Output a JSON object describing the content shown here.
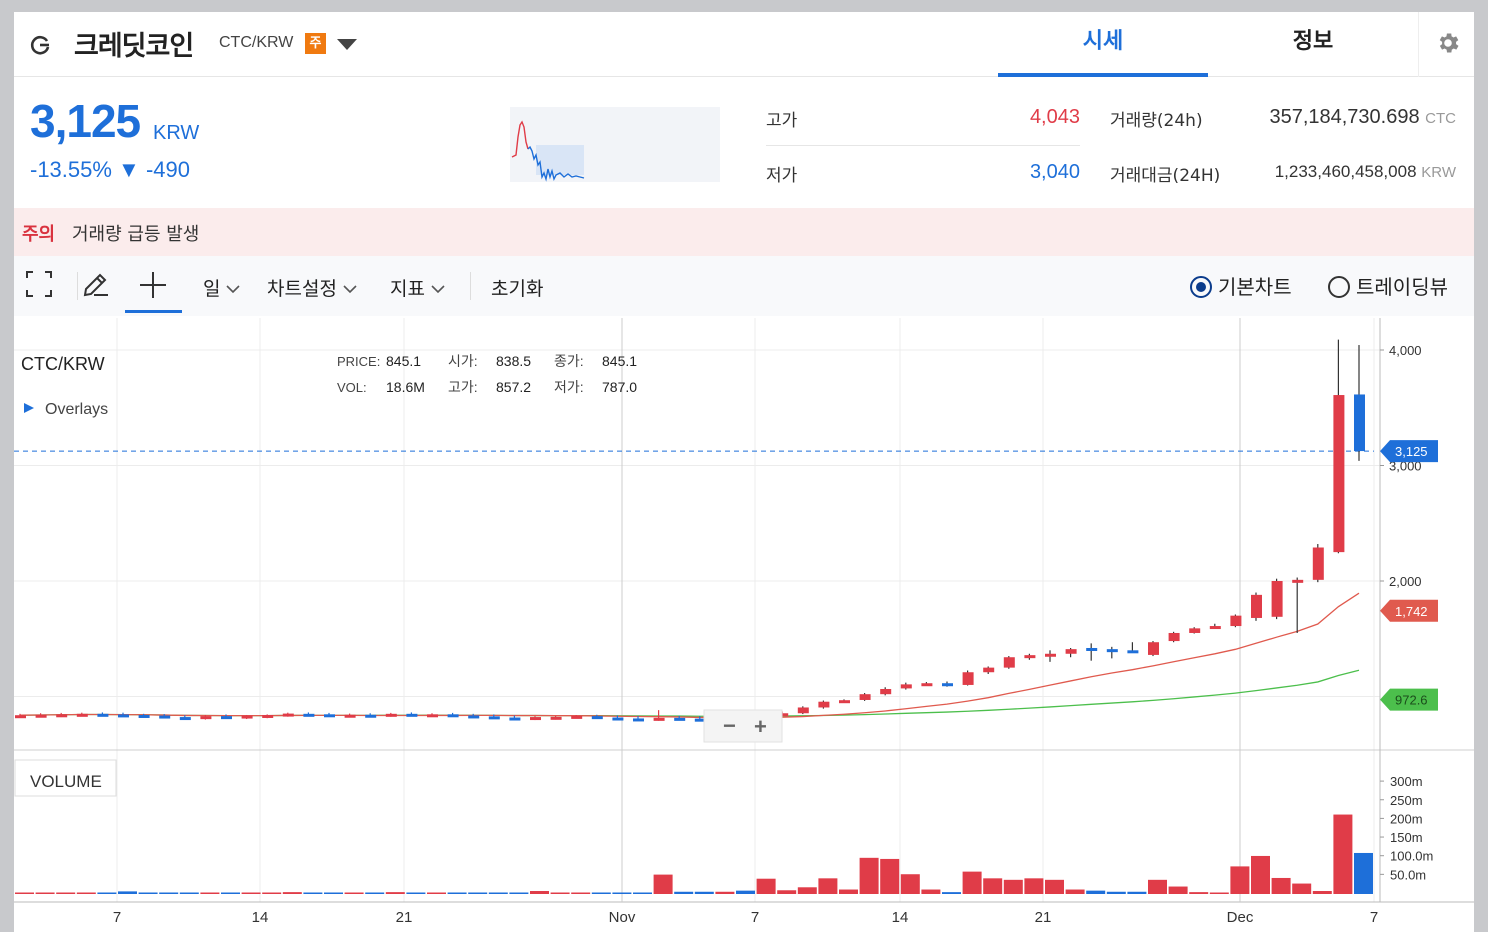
{
  "header": {
    "coin_name": "크레딧코인",
    "pair": "CTC/KRW",
    "warning_badge": "주",
    "tabs": [
      {
        "label": "시세",
        "active": true
      },
      {
        "label": "정보",
        "active": false
      }
    ],
    "icons": {
      "refresh": "refresh-icon",
      "caret": "caret-down-icon",
      "settings": "gear-icon"
    }
  },
  "summary": {
    "price": "3,125",
    "price_unit": "KRW",
    "change": "-13.55% ▼ -490",
    "high_label": "고가",
    "high_value": "4,043",
    "low_label": "저가",
    "low_value": "3,040",
    "volume_label": "거래량(24h)",
    "volume_value": "357,184,730.698",
    "volume_unit": "CTC",
    "amount_label": "거래대금(24H)",
    "amount_value": "1,233,460,458,008",
    "amount_unit": "KRW"
  },
  "notice": {
    "tag": "주의",
    "text": "거래량 급등 발생"
  },
  "toolbar": {
    "interval": "일",
    "chart_settings": "차트설정",
    "indicators": "지표",
    "reset": "초기화",
    "radio_basic": "기본차트",
    "radio_tradingview": "트레이딩뷰",
    "selected": "기본차트"
  },
  "colors": {
    "up": "#e03c48",
    "down": "#1e6fd9",
    "accent": "#1e6fd9",
    "ma_short": "#e05a4e",
    "ma_long": "#4cbf4c"
  },
  "chart_info": {
    "symbol": "CTC/KRW",
    "overlays": "Overlays",
    "price_label": "PRICE:",
    "price": "845.1",
    "open_label": "시가:",
    "open": "838.5",
    "close_label": "종가:",
    "close": "845.1",
    "vol_label": "VOL:",
    "vol": "18.6M",
    "high_label": "고가:",
    "high": "857.2",
    "low_label": "저가:",
    "low": "787.0",
    "volume_title": "VOLUME",
    "zoom_out": "−",
    "zoom_in": "+"
  },
  "chart_data": {
    "type": "candlestick",
    "price_axis": {
      "ticks": [
        "4,000",
        "3,000",
        "2,000"
      ],
      "values": [
        4000,
        3000,
        2000
      ]
    },
    "volume_axis": {
      "ticks": [
        "300m",
        "250m",
        "200m",
        "150m",
        "100.0m",
        "50.0m"
      ],
      "values": [
        300,
        250,
        200,
        150,
        100,
        50
      ]
    },
    "x_labels": [
      "7",
      "14",
      "21",
      "Nov",
      "7",
      "14",
      "21",
      "Dec",
      "7"
    ],
    "price_markers": [
      {
        "label": "3,125",
        "value": 3125,
        "color": "#1e6fd9"
      },
      {
        "label": "1,742",
        "value": 1742,
        "color": "#e05a4e"
      },
      {
        "label": "972.6",
        "value": 972.6,
        "color": "#4cbf4c"
      }
    ],
    "candles": [
      {
        "o": 830,
        "h": 850,
        "l": 815,
        "c": 838,
        "v": 2
      },
      {
        "o": 835,
        "h": 855,
        "l": 820,
        "c": 842,
        "v": 2
      },
      {
        "o": 840,
        "h": 858,
        "l": 822,
        "c": 846,
        "v": 2
      },
      {
        "o": 846,
        "h": 860,
        "l": 830,
        "c": 850,
        "v": 2
      },
      {
        "o": 850,
        "h": 862,
        "l": 835,
        "c": 844,
        "v": 2
      },
      {
        "o": 845,
        "h": 860,
        "l": 830,
        "c": 840,
        "v": 7
      },
      {
        "o": 840,
        "h": 850,
        "l": 825,
        "c": 834,
        "v": 2
      },
      {
        "o": 835,
        "h": 848,
        "l": 818,
        "c": 822,
        "v": 2
      },
      {
        "o": 822,
        "h": 838,
        "l": 805,
        "c": 810,
        "v": 2
      },
      {
        "o": 812,
        "h": 840,
        "l": 800,
        "c": 830,
        "v": 2
      },
      {
        "o": 830,
        "h": 845,
        "l": 815,
        "c": 820,
        "v": 2
      },
      {
        "o": 822,
        "h": 840,
        "l": 805,
        "c": 835,
        "v": 2
      },
      {
        "o": 825,
        "h": 845,
        "l": 812,
        "c": 840,
        "v": 2
      },
      {
        "o": 835,
        "h": 860,
        "l": 825,
        "c": 852,
        "v": 5
      },
      {
        "o": 850,
        "h": 862,
        "l": 832,
        "c": 846,
        "v": 2
      },
      {
        "o": 846,
        "h": 858,
        "l": 828,
        "c": 834,
        "v": 2
      },
      {
        "o": 834,
        "h": 852,
        "l": 820,
        "c": 842,
        "v": 2
      },
      {
        "o": 842,
        "h": 855,
        "l": 826,
        "c": 838,
        "v": 2
      },
      {
        "o": 838,
        "h": 858,
        "l": 825,
        "c": 850,
        "v": 5
      },
      {
        "o": 850,
        "h": 862,
        "l": 832,
        "c": 840,
        "v": 2
      },
      {
        "o": 842,
        "h": 855,
        "l": 828,
        "c": 846,
        "v": 2
      },
      {
        "o": 846,
        "h": 858,
        "l": 830,
        "c": 836,
        "v": 2
      },
      {
        "o": 836,
        "h": 850,
        "l": 820,
        "c": 825,
        "v": 2
      },
      {
        "o": 828,
        "h": 845,
        "l": 812,
        "c": 818,
        "v": 2
      },
      {
        "o": 818,
        "h": 835,
        "l": 798,
        "c": 805,
        "v": 2
      },
      {
        "o": 805,
        "h": 830,
        "l": 796,
        "c": 822,
        "v": 8
      },
      {
        "o": 816,
        "h": 832,
        "l": 800,
        "c": 824,
        "v": 2
      },
      {
        "o": 824,
        "h": 840,
        "l": 810,
        "c": 832,
        "v": 2
      },
      {
        "o": 830,
        "h": 842,
        "l": 812,
        "c": 818,
        "v": 2
      },
      {
        "o": 818,
        "h": 836,
        "l": 802,
        "c": 808,
        "v": 2
      },
      {
        "o": 810,
        "h": 830,
        "l": 795,
        "c": 800,
        "v": 2
      },
      {
        "o": 805,
        "h": 882,
        "l": 790,
        "c": 815,
        "v": 52
      },
      {
        "o": 815,
        "h": 832,
        "l": 798,
        "c": 808,
        "v": 6
      },
      {
        "o": 808,
        "h": 830,
        "l": 790,
        "c": 786,
        "v": 6
      },
      {
        "o": 790,
        "h": 840,
        "l": 785,
        "c": 830,
        "v": 6
      },
      {
        "o": 830,
        "h": 852,
        "l": 815,
        "c": 820,
        "v": 9
      },
      {
        "o": 820,
        "h": 875,
        "l": 815,
        "c": 868,
        "v": 41
      },
      {
        "o": 845,
        "h": 870,
        "l": 830,
        "c": 855,
        "v": 10
      },
      {
        "o": 855,
        "h": 915,
        "l": 848,
        "c": 905,
        "v": 18
      },
      {
        "o": 905,
        "h": 965,
        "l": 895,
        "c": 955,
        "v": 42
      },
      {
        "o": 960,
        "h": 975,
        "l": 945,
        "c": 968,
        "v": 12
      },
      {
        "o": 970,
        "h": 1030,
        "l": 962,
        "c": 1020,
        "v": 97
      },
      {
        "o": 1020,
        "h": 1080,
        "l": 1010,
        "c": 1065,
        "v": 94
      },
      {
        "o": 1070,
        "h": 1120,
        "l": 1060,
        "c": 1105,
        "v": 53
      },
      {
        "o": 1105,
        "h": 1125,
        "l": 1095,
        "c": 1115,
        "v": 12
      },
      {
        "o": 1115,
        "h": 1130,
        "l": 1085,
        "c": 1095,
        "v": 5
      },
      {
        "o": 1100,
        "h": 1225,
        "l": 1095,
        "c": 1210,
        "v": 60
      },
      {
        "o": 1210,
        "h": 1260,
        "l": 1195,
        "c": 1250,
        "v": 42
      },
      {
        "o": 1250,
        "h": 1350,
        "l": 1240,
        "c": 1340,
        "v": 38
      },
      {
        "o": 1335,
        "h": 1370,
        "l": 1318,
        "c": 1358,
        "v": 42
      },
      {
        "o": 1360,
        "h": 1400,
        "l": 1300,
        "c": 1370,
        "v": 38
      },
      {
        "o": 1370,
        "h": 1420,
        "l": 1340,
        "c": 1410,
        "v": 12
      },
      {
        "o": 1420,
        "h": 1460,
        "l": 1310,
        "c": 1400,
        "v": 9
      },
      {
        "o": 1410,
        "h": 1430,
        "l": 1330,
        "c": 1395,
        "v": 6
      },
      {
        "o": 1400,
        "h": 1470,
        "l": 1380,
        "c": 1380,
        "v": 6
      },
      {
        "o": 1360,
        "h": 1480,
        "l": 1350,
        "c": 1470,
        "v": 38
      },
      {
        "o": 1480,
        "h": 1560,
        "l": 1470,
        "c": 1550,
        "v": 20
      },
      {
        "o": 1550,
        "h": 1600,
        "l": 1545,
        "c": 1590,
        "v": 5
      },
      {
        "o": 1590,
        "h": 1630,
        "l": 1585,
        "c": 1610,
        "v": 2
      },
      {
        "o": 1610,
        "h": 1710,
        "l": 1600,
        "c": 1700,
        "v": 74
      },
      {
        "o": 1680,
        "h": 1900,
        "l": 1655,
        "c": 1880,
        "v": 102
      },
      {
        "o": 1690,
        "h": 2020,
        "l": 1670,
        "c": 2000,
        "v": 43
      },
      {
        "o": 2000,
        "h": 2030,
        "l": 1550,
        "c": 2010,
        "v": 28
      },
      {
        "o": 2010,
        "h": 2320,
        "l": 1990,
        "c": 2290,
        "v": 8
      },
      {
        "o": 2250,
        "h": 4090,
        "l": 2240,
        "c": 3610,
        "v": 213
      },
      {
        "o": 3615,
        "h": 4043,
        "l": 3040,
        "c": 3125,
        "v": 110
      }
    ]
  }
}
